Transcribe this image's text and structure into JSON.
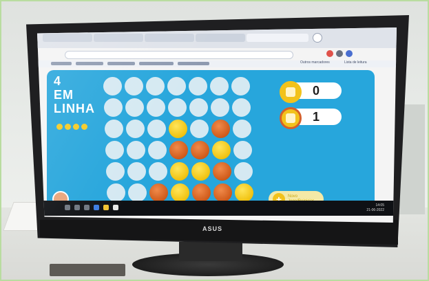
{
  "monitor": {
    "brand": "ASUS"
  },
  "browser": {
    "tabs": [
      "",
      "",
      "",
      "",
      "",
      "",
      ""
    ],
    "bookmarks_right": [
      "Outros marcadores",
      "Lista de leitura"
    ]
  },
  "game": {
    "title_lines": [
      "4",
      "EM",
      "LINHA"
    ],
    "player1_score": "0",
    "player2_score": "1",
    "new_game_label_line1": "Novo",
    "new_game_label_line2": "Jogo/Reiniciar",
    "board": [
      [
        "empty",
        "empty",
        "empty",
        "empty",
        "empty",
        "empty",
        "empty"
      ],
      [
        "empty",
        "empty",
        "empty",
        "empty",
        "empty",
        "empty",
        "empty"
      ],
      [
        "empty",
        "empty",
        "empty",
        "yellow",
        "empty",
        "orange",
        "empty"
      ],
      [
        "empty",
        "empty",
        "empty",
        "orange",
        "orange",
        "yellow",
        "empty"
      ],
      [
        "empty",
        "empty",
        "empty",
        "yellow",
        "yellow",
        "orange",
        "empty"
      ],
      [
        "empty",
        "empty",
        "orange",
        "yellow",
        "orange",
        "orange",
        "yellow"
      ]
    ],
    "colors": {
      "board_bg": "#27a6dc",
      "yellow": "#f0c210",
      "orange": "#cf5a1a",
      "empty": "#d5e9f2"
    }
  },
  "taskbar": {
    "time": "14:05",
    "date": "21-06-2022"
  }
}
